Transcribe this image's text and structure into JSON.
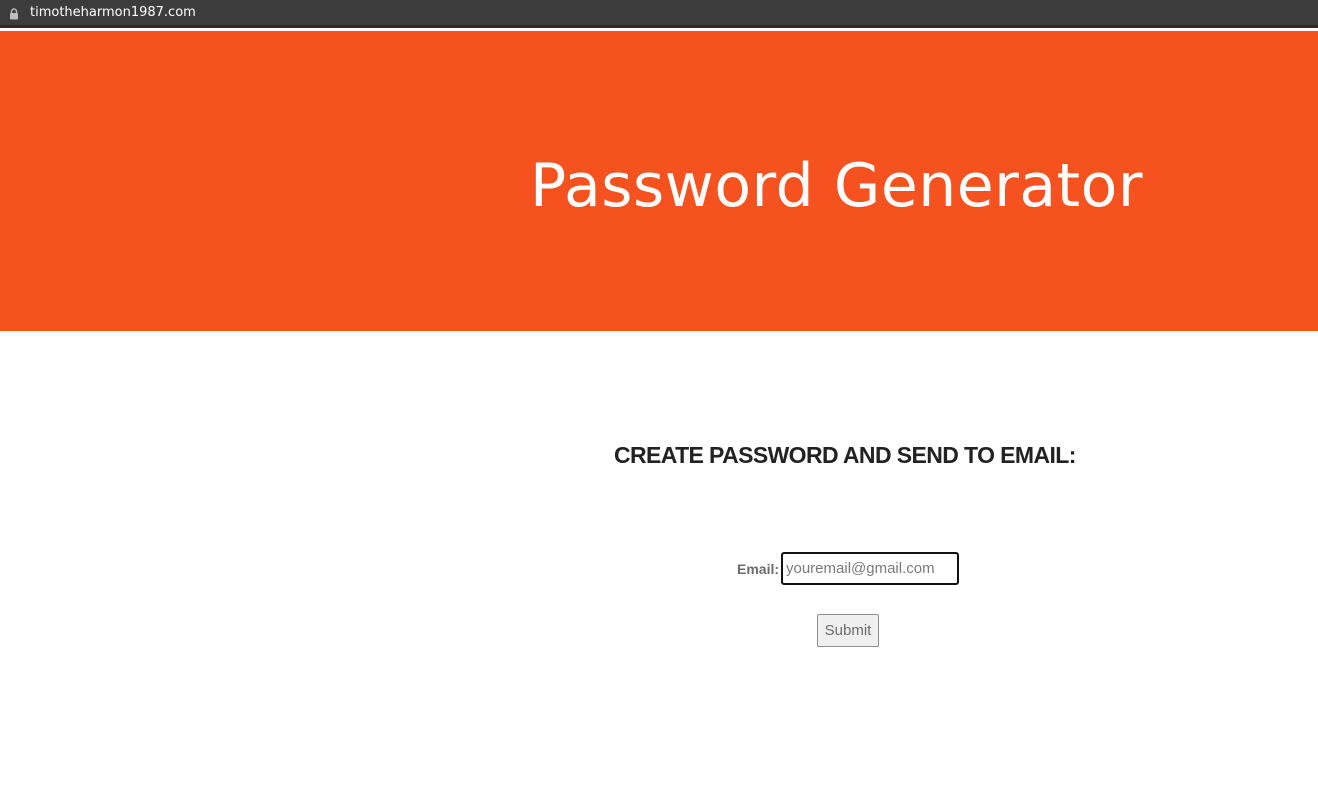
{
  "browser": {
    "url": "timotheharmon1987.com",
    "lock_icon": "lock-icon"
  },
  "hero": {
    "title": "Password Generator",
    "background_color": "#f5521f",
    "text_color": "#ffffff"
  },
  "form": {
    "heading": "CREATE PASSWORD AND SEND TO EMAIL:",
    "email_label": "Email:",
    "email_placeholder": "youremail@gmail.com",
    "email_value": "",
    "submit_label": "Submit"
  }
}
